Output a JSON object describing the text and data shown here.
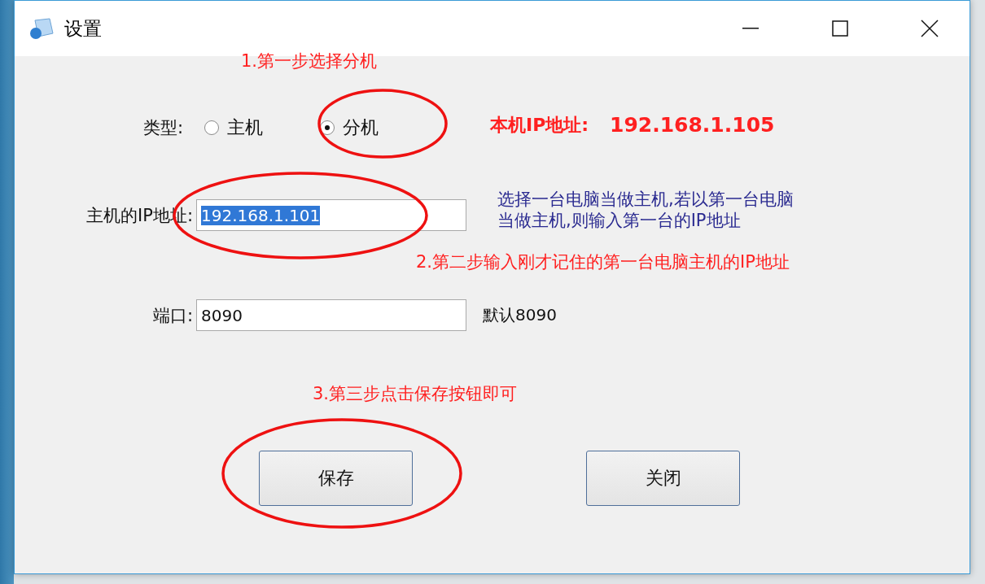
{
  "window": {
    "title": "设置"
  },
  "type_row": {
    "label": "类型:",
    "options": [
      {
        "label": "主机",
        "selected": false
      },
      {
        "label": "分机",
        "selected": true
      }
    ]
  },
  "local_ip": {
    "label": "本机IP地址:",
    "value": "192.168.1.105"
  },
  "host_ip": {
    "label": "主机的IP地址:",
    "value": "192.168.1.101",
    "text_selected": true,
    "hint_lines": [
      "选择一台电脑当做主机,若以第一台电脑",
      "当做主机,则输入第一台的IP地址"
    ]
  },
  "port": {
    "label": "端口:",
    "value": "8090",
    "hint": "默认8090"
  },
  "buttons": [
    {
      "label": "保存"
    },
    {
      "label": "关闭"
    }
  ],
  "annotations": [
    {
      "text": "1.第一步选择分机"
    },
    {
      "text": "2.第二步输入刚才记住的第一台电脑主机的IP地址"
    },
    {
      "text": "3.第三步点击保存按钮即可"
    }
  ]
}
